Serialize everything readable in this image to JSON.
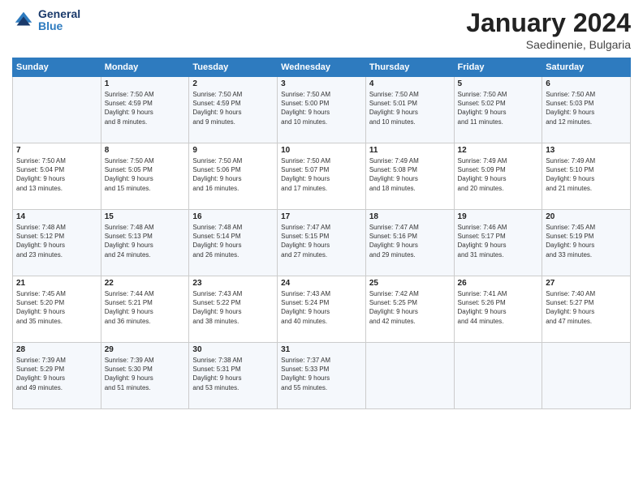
{
  "header": {
    "logo_line1": "General",
    "logo_line2": "Blue",
    "month": "January 2024",
    "location": "Saedinenie, Bulgaria"
  },
  "days_of_week": [
    "Sunday",
    "Monday",
    "Tuesday",
    "Wednesday",
    "Thursday",
    "Friday",
    "Saturday"
  ],
  "weeks": [
    [
      {
        "num": "",
        "info": ""
      },
      {
        "num": "1",
        "info": "Sunrise: 7:50 AM\nSunset: 4:59 PM\nDaylight: 9 hours\nand 8 minutes."
      },
      {
        "num": "2",
        "info": "Sunrise: 7:50 AM\nSunset: 4:59 PM\nDaylight: 9 hours\nand 9 minutes."
      },
      {
        "num": "3",
        "info": "Sunrise: 7:50 AM\nSunset: 5:00 PM\nDaylight: 9 hours\nand 10 minutes."
      },
      {
        "num": "4",
        "info": "Sunrise: 7:50 AM\nSunset: 5:01 PM\nDaylight: 9 hours\nand 10 minutes."
      },
      {
        "num": "5",
        "info": "Sunrise: 7:50 AM\nSunset: 5:02 PM\nDaylight: 9 hours\nand 11 minutes."
      },
      {
        "num": "6",
        "info": "Sunrise: 7:50 AM\nSunset: 5:03 PM\nDaylight: 9 hours\nand 12 minutes."
      }
    ],
    [
      {
        "num": "7",
        "info": "Sunrise: 7:50 AM\nSunset: 5:04 PM\nDaylight: 9 hours\nand 13 minutes."
      },
      {
        "num": "8",
        "info": "Sunrise: 7:50 AM\nSunset: 5:05 PM\nDaylight: 9 hours\nand 15 minutes."
      },
      {
        "num": "9",
        "info": "Sunrise: 7:50 AM\nSunset: 5:06 PM\nDaylight: 9 hours\nand 16 minutes."
      },
      {
        "num": "10",
        "info": "Sunrise: 7:50 AM\nSunset: 5:07 PM\nDaylight: 9 hours\nand 17 minutes."
      },
      {
        "num": "11",
        "info": "Sunrise: 7:49 AM\nSunset: 5:08 PM\nDaylight: 9 hours\nand 18 minutes."
      },
      {
        "num": "12",
        "info": "Sunrise: 7:49 AM\nSunset: 5:09 PM\nDaylight: 9 hours\nand 20 minutes."
      },
      {
        "num": "13",
        "info": "Sunrise: 7:49 AM\nSunset: 5:10 PM\nDaylight: 9 hours\nand 21 minutes."
      }
    ],
    [
      {
        "num": "14",
        "info": "Sunrise: 7:48 AM\nSunset: 5:12 PM\nDaylight: 9 hours\nand 23 minutes."
      },
      {
        "num": "15",
        "info": "Sunrise: 7:48 AM\nSunset: 5:13 PM\nDaylight: 9 hours\nand 24 minutes."
      },
      {
        "num": "16",
        "info": "Sunrise: 7:48 AM\nSunset: 5:14 PM\nDaylight: 9 hours\nand 26 minutes."
      },
      {
        "num": "17",
        "info": "Sunrise: 7:47 AM\nSunset: 5:15 PM\nDaylight: 9 hours\nand 27 minutes."
      },
      {
        "num": "18",
        "info": "Sunrise: 7:47 AM\nSunset: 5:16 PM\nDaylight: 9 hours\nand 29 minutes."
      },
      {
        "num": "19",
        "info": "Sunrise: 7:46 AM\nSunset: 5:17 PM\nDaylight: 9 hours\nand 31 minutes."
      },
      {
        "num": "20",
        "info": "Sunrise: 7:45 AM\nSunset: 5:19 PM\nDaylight: 9 hours\nand 33 minutes."
      }
    ],
    [
      {
        "num": "21",
        "info": "Sunrise: 7:45 AM\nSunset: 5:20 PM\nDaylight: 9 hours\nand 35 minutes."
      },
      {
        "num": "22",
        "info": "Sunrise: 7:44 AM\nSunset: 5:21 PM\nDaylight: 9 hours\nand 36 minutes."
      },
      {
        "num": "23",
        "info": "Sunrise: 7:43 AM\nSunset: 5:22 PM\nDaylight: 9 hours\nand 38 minutes."
      },
      {
        "num": "24",
        "info": "Sunrise: 7:43 AM\nSunset: 5:24 PM\nDaylight: 9 hours\nand 40 minutes."
      },
      {
        "num": "25",
        "info": "Sunrise: 7:42 AM\nSunset: 5:25 PM\nDaylight: 9 hours\nand 42 minutes."
      },
      {
        "num": "26",
        "info": "Sunrise: 7:41 AM\nSunset: 5:26 PM\nDaylight: 9 hours\nand 44 minutes."
      },
      {
        "num": "27",
        "info": "Sunrise: 7:40 AM\nSunset: 5:27 PM\nDaylight: 9 hours\nand 47 minutes."
      }
    ],
    [
      {
        "num": "28",
        "info": "Sunrise: 7:39 AM\nSunset: 5:29 PM\nDaylight: 9 hours\nand 49 minutes."
      },
      {
        "num": "29",
        "info": "Sunrise: 7:39 AM\nSunset: 5:30 PM\nDaylight: 9 hours\nand 51 minutes."
      },
      {
        "num": "30",
        "info": "Sunrise: 7:38 AM\nSunset: 5:31 PM\nDaylight: 9 hours\nand 53 minutes."
      },
      {
        "num": "31",
        "info": "Sunrise: 7:37 AM\nSunset: 5:33 PM\nDaylight: 9 hours\nand 55 minutes."
      },
      {
        "num": "",
        "info": ""
      },
      {
        "num": "",
        "info": ""
      },
      {
        "num": "",
        "info": ""
      }
    ]
  ]
}
